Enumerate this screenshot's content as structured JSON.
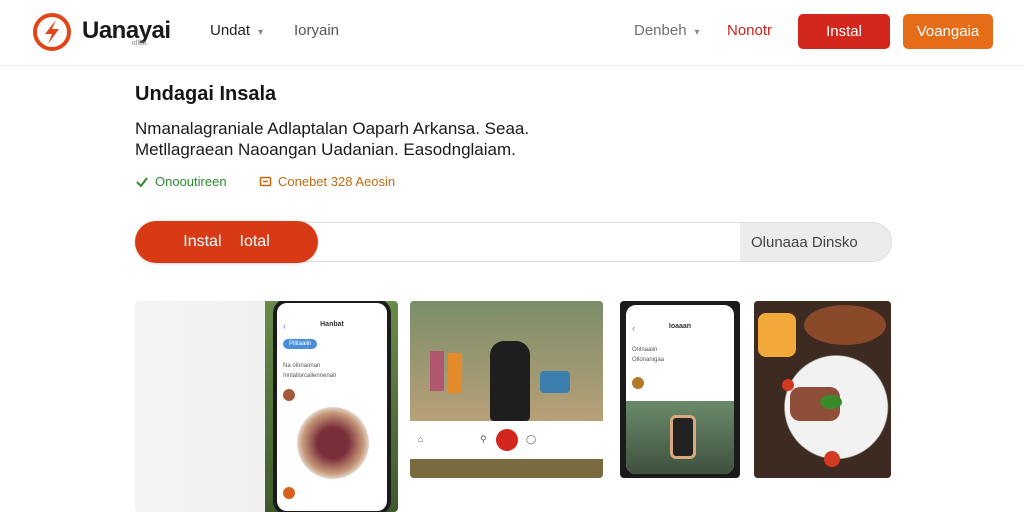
{
  "header": {
    "brand": "Uanayai",
    "brand_sub": "idlba",
    "nav": [
      {
        "label": "Undat"
      },
      {
        "label": "Ioryain"
      }
    ],
    "right_nav": [
      {
        "label": "Denbeh"
      },
      {
        "label": "Nonotr"
      }
    ],
    "install_label": "Instal",
    "secondary_label": "Voangaia"
  },
  "hero": {
    "title": "Undagai Insala",
    "description_line1": "Nmanalagraniale Adlaptalan Oaparh Arkansa. Seaa.",
    "description_line2": "Metllagraean Naoangan Uadanian. Easodnglaiam.",
    "badge_verified": "Onooutireen",
    "badge_rating": "Conebet 328 Aeosin"
  },
  "search": {
    "button_label_1": "Instal",
    "button_label_2": "Iotal",
    "placeholder": "",
    "online_tag": "Olunaaa Dinsko"
  },
  "screenshots": {
    "phone1_title": "Hanbat",
    "phone1_chip": "Pilitaaiin",
    "phone1_text1": "Na olonaonan",
    "phone1_text2": "Innlallorcallennenan",
    "phone3_title": "Ioaaan",
    "phone3_text1": "Onlnaaiin",
    "phone3_text2": "Ollonanigaa"
  },
  "colors": {
    "accent_red": "#d3261c",
    "accent_orange": "#e56d1a",
    "verified_green": "#2d8a2f",
    "rating_orange": "#c46a12"
  }
}
